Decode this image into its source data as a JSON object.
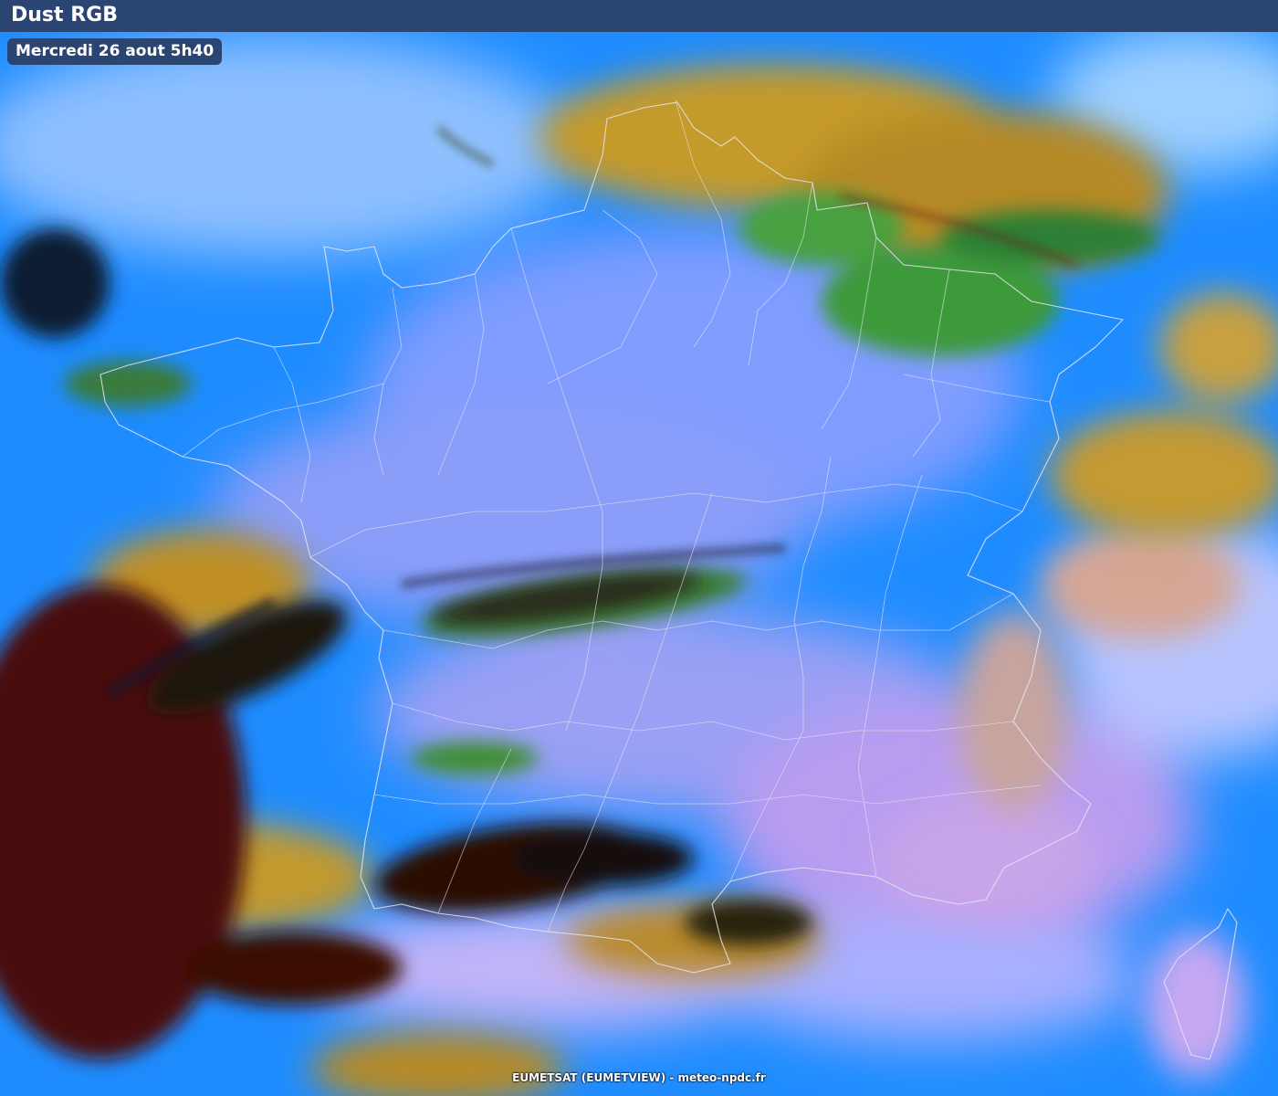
{
  "header": {
    "title": "Dust RGB"
  },
  "timestamp": "Mercredi 26 aout 5h40",
  "credit": "EUMETSAT (EUMETVIEW) - meteo-npdc.fr",
  "colors": {
    "header_bg": "#2b4572",
    "sea_blue": "#1e8cff",
    "light_cloud": "#a9c8ff",
    "lavender_cloud": "#b9a8f0",
    "dust_orange": "#c89a2a",
    "green_cloud": "#3f9a3a",
    "dark_red": "#5a0f08",
    "border_line": "#e6e6f0"
  },
  "map": {
    "type": "satellite-composite",
    "product": "Dust RGB",
    "region_visible": [
      "France",
      "Corse"
    ]
  }
}
